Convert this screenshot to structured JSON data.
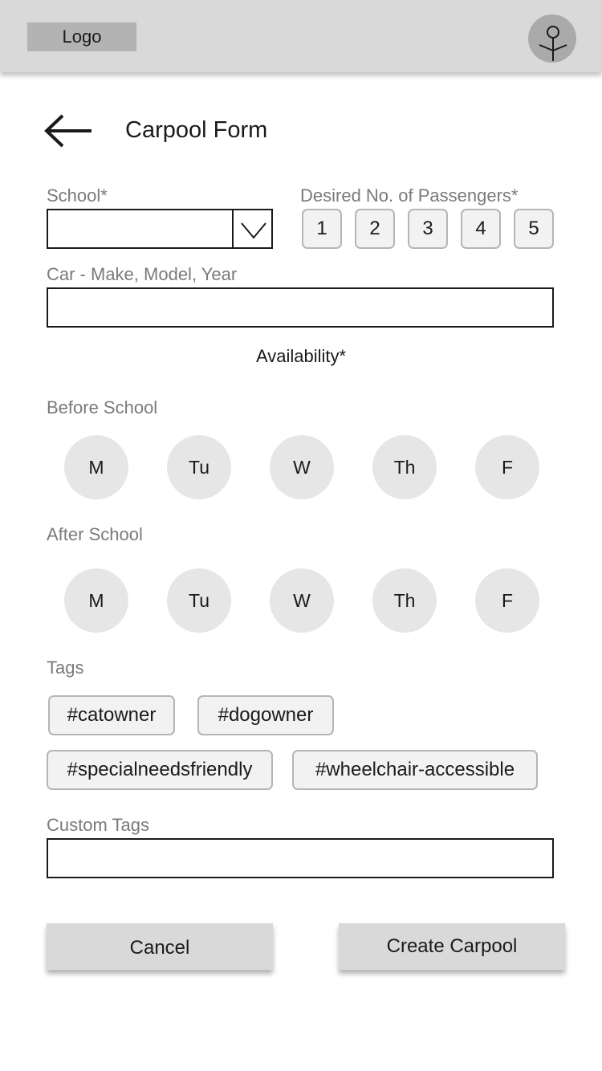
{
  "header": {
    "logo": "Logo",
    "avatar_icon": "user-avatar-icon"
  },
  "page": {
    "back_icon": "arrow-left-icon",
    "title": "Carpool Form"
  },
  "school": {
    "label": "School*",
    "value": "",
    "dropdown_icon": "chevron-down-icon"
  },
  "passengers": {
    "label": "Desired No. of Passengers*",
    "options": [
      "1",
      "2",
      "3",
      "4",
      "5"
    ]
  },
  "car": {
    "label": "Car - Make, Model, Year",
    "value": ""
  },
  "availability": {
    "title": "Availability*",
    "before_label": "Before School",
    "after_label": "After School",
    "days": [
      "M",
      "Tu",
      "W",
      "Th",
      "F"
    ]
  },
  "tags": {
    "label": "Tags",
    "items": [
      "#catowner",
      "#dogowner",
      "#specialneedsfriendly",
      "#wheelchair-accessible"
    ]
  },
  "custom_tags": {
    "label": "Custom Tags",
    "value": ""
  },
  "actions": {
    "cancel": "Cancel",
    "create": "Create Carpool"
  },
  "colors": {
    "header_bg": "#d9d9d9",
    "logo_bg": "#b3b3b3",
    "day_bg": "#e6e6e6",
    "chip_bg": "#f2f2f2",
    "label_text": "#7a7a7a"
  }
}
